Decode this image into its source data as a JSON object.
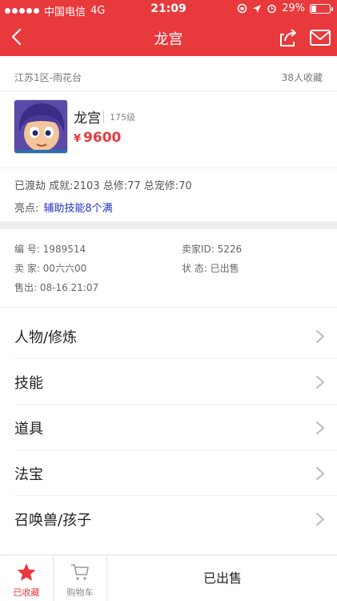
{
  "status_bar": {
    "carrier": "中国电信",
    "network": "4G",
    "time": "21:09",
    "battery": "29%",
    "battery_level": 0.29
  },
  "nav": {
    "title": "龙宫",
    "back_icon": "chevron-left-icon",
    "share_icon": "share-icon",
    "mail_icon": "mail-icon"
  },
  "location": {
    "server": "江苏1区-雨花台",
    "collect_count": "38人收藏"
  },
  "character": {
    "name": "龙宫",
    "level": "175级",
    "price_symbol": "¥",
    "price": "9600"
  },
  "achievement_text": "已渡劫 成就:2103 总修:77 总宠修:70",
  "highlight": {
    "label": "亮点:",
    "value": "辅助技能8个满"
  },
  "info": {
    "number": "编   号: 1989514",
    "seller_id": "卖家ID: 5226",
    "seller": "卖   家: 00六六00",
    "state": "状   态: 已出售",
    "sold_at": "售出: 08-16 21:07"
  },
  "menu": [
    {
      "label": "人物/修炼"
    },
    {
      "label": "技能"
    },
    {
      "label": "道具"
    },
    {
      "label": "法宝"
    },
    {
      "label": "召唤兽/孩子"
    }
  ],
  "bottom": {
    "collected_label": "已收藏",
    "cart_label": "购物车",
    "sold_label": "已出售"
  },
  "colors": {
    "brand_red": "#e8393c",
    "highlight_blue": "#2233c8"
  }
}
